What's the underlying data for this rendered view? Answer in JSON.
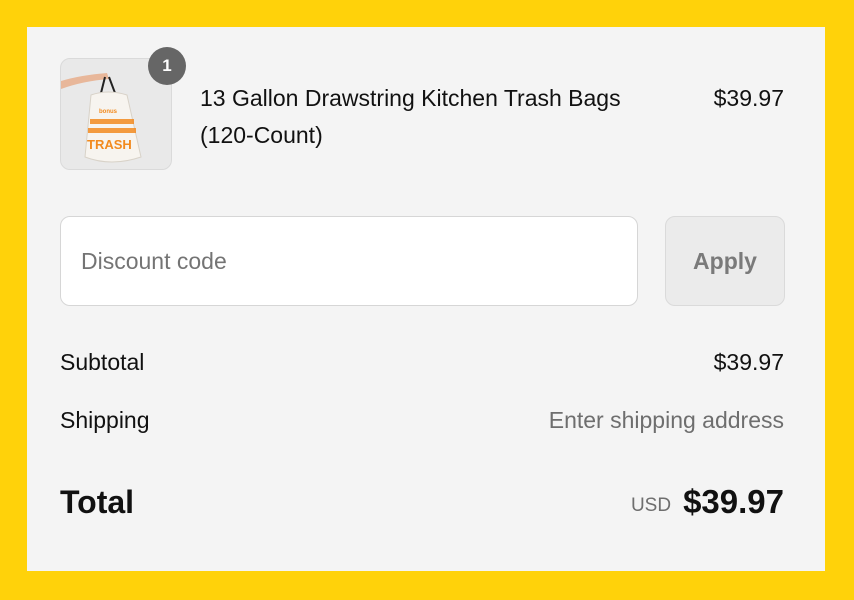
{
  "cart": {
    "item": {
      "name": "13 Gallon Drawstring Kitchen Trash Bags (120-Count)",
      "price": "$39.97",
      "quantity": "1",
      "image_icon": "trash-bag-product-image",
      "bag_text": "TRASH"
    }
  },
  "discount": {
    "placeholder": "Discount code",
    "value": "",
    "apply_label": "Apply"
  },
  "summary": {
    "subtotal_label": "Subtotal",
    "subtotal_value": "$39.97",
    "shipping_label": "Shipping",
    "shipping_value": "Enter shipping address",
    "total_label": "Total",
    "currency": "USD",
    "total_value": "$39.97"
  },
  "colors": {
    "background": "#FFD20A",
    "panel": "#F4F4F4",
    "badge": "#666666",
    "bag_print": "#F28A1E"
  }
}
